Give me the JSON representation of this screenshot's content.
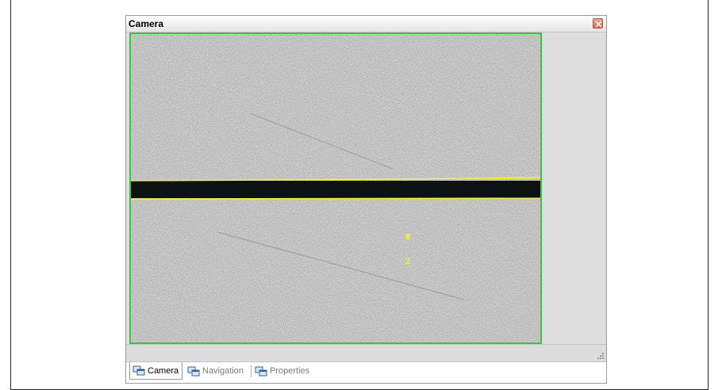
{
  "window": {
    "title": "Camera"
  },
  "viewport": {
    "markers": [
      "8",
      "2"
    ],
    "marker_color": "#ffff00",
    "border_color": "#37c837"
  },
  "tabs": [
    {
      "label": "Camera",
      "icon": "window-icon",
      "active": true
    },
    {
      "label": "Navigation",
      "icon": "window-icon",
      "active": false
    },
    {
      "label": "Properties",
      "icon": "window-icon",
      "active": false
    }
  ]
}
